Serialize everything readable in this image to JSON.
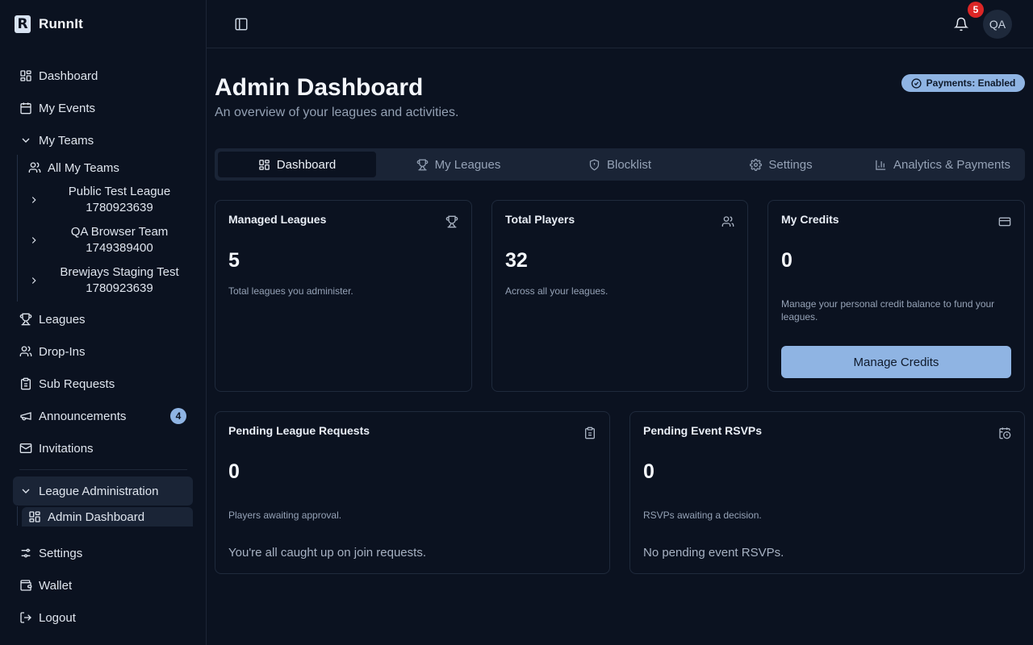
{
  "app": {
    "name": "RunnIt",
    "logo_letter": "R"
  },
  "sidebar": {
    "items": {
      "dashboard": "Dashboard",
      "my_events": "My Events",
      "my_teams": "My Teams",
      "all_my_teams": "All My Teams",
      "leagues": "Leagues",
      "drop_ins": "Drop-Ins",
      "sub_requests": "Sub Requests",
      "announcements": "Announcements",
      "announcements_count": "4",
      "invitations": "Invitations",
      "league_administration": "League Administration",
      "admin_dashboard": "Admin Dashboard",
      "settings": "Settings",
      "wallet": "Wallet",
      "logout": "Logout"
    },
    "teams": [
      {
        "name": "Public Test League",
        "id": "1780923639"
      },
      {
        "name": "QA Browser Team",
        "id": "1749389400"
      },
      {
        "name": "Brewjays Staging Test",
        "id": "1780923639"
      }
    ]
  },
  "header": {
    "notification_count": "5",
    "avatar_initials": "QA"
  },
  "main": {
    "title": "Admin Dashboard",
    "subtitle": "An overview of your leagues and activities.",
    "payments_badge": "Payments: Enabled",
    "tabs": [
      "Dashboard",
      "My Leagues",
      "Blocklist",
      "Settings",
      "Analytics & Payments"
    ],
    "cards": {
      "managed_leagues": {
        "title": "Managed Leagues",
        "value": "5",
        "desc": "Total leagues you administer."
      },
      "total_players": {
        "title": "Total Players",
        "value": "32",
        "desc": "Across all your leagues."
      },
      "my_credits": {
        "title": "My Credits",
        "value": "0",
        "desc": "Manage your personal credit balance to fund your leagues.",
        "button": "Manage Credits"
      },
      "pending_league_requests": {
        "title": "Pending League Requests",
        "value": "0",
        "desc": "Players awaiting approval.",
        "note": "You're all caught up on join requests."
      },
      "pending_event_rsvps": {
        "title": "Pending Event RSVPs",
        "value": "0",
        "desc": "RSVPs awaiting a decision.",
        "note": "No pending event RSVPs."
      }
    }
  },
  "colors": {
    "accent": "#8fb4e3",
    "background": "#0b1220",
    "badge_red": "#dc2626"
  }
}
